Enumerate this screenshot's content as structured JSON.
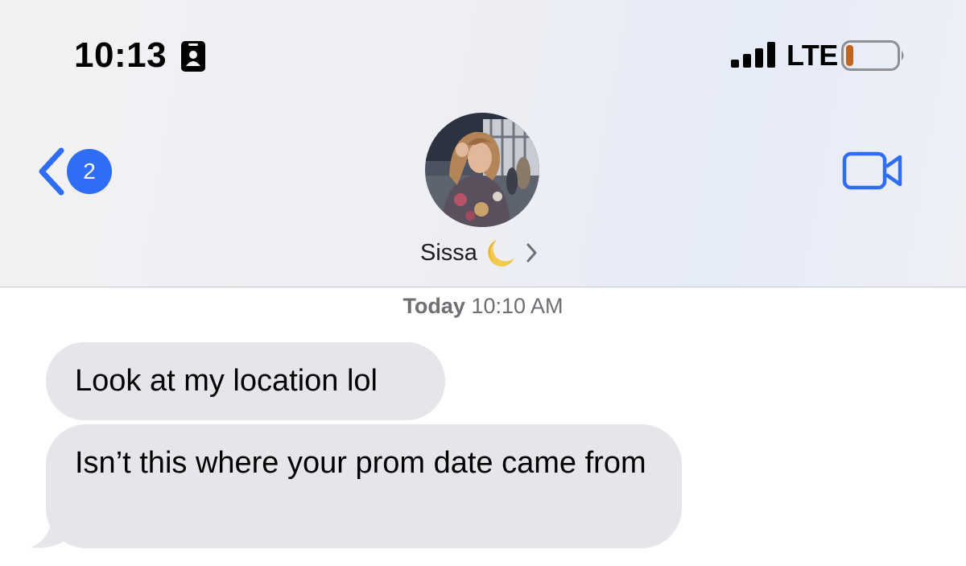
{
  "status_bar": {
    "time": "10:13",
    "network": "LTE",
    "battery_level": 0.15,
    "icons": [
      "contact-card-icon",
      "signal-bars-icon",
      "battery-icon"
    ]
  },
  "nav": {
    "unread_count": "2",
    "contact_name": "Sissa",
    "contact_emoji": "🌙",
    "icons": [
      "back-chevron-icon",
      "chevron-right-icon",
      "video-camera-icon"
    ]
  },
  "conversation": {
    "timestamp_day": "Today",
    "timestamp_time": "10:10 AM",
    "messages": [
      {
        "direction": "incoming",
        "text": "Look at my location lol"
      },
      {
        "direction": "incoming",
        "text": "Isn’t this where your prom date came from"
      }
    ]
  },
  "colors": {
    "accent": "#2f6df6",
    "bubble_incoming": "#e5e5ea",
    "battery_fill": "#c0651f"
  }
}
